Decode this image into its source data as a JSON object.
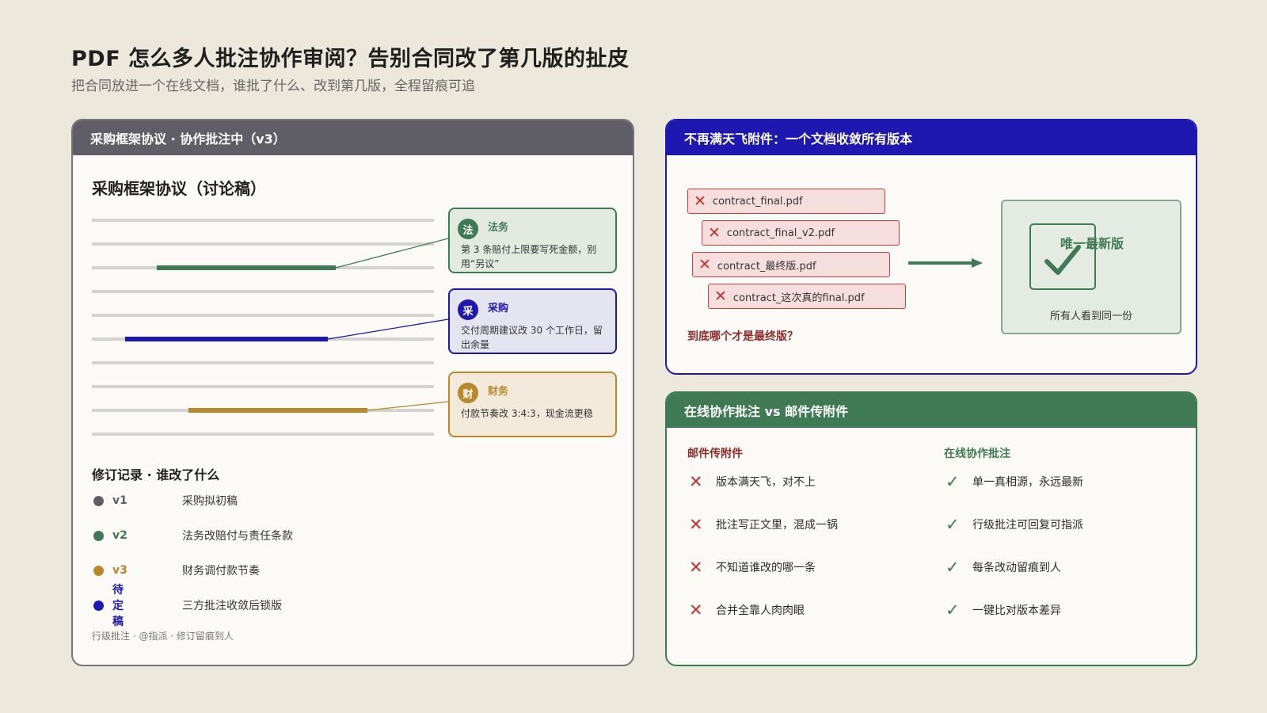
{
  "page": {
    "title": "PDF 怎么多人批注协作审阅？告别合同改了第几版的扯皮",
    "subtitle": "把合同放进一个在线文档，谁批了什么、改到第几版，全程留痕可追"
  },
  "doc_card": {
    "header": "采购框架协议 · 协作批注中（v3）",
    "doc_title": "采购框架协议（讨论稿）",
    "notes": [
      {
        "avatar": "法",
        "who": "法务",
        "text": "第 3 条赔付上限要写死金额，别用“另议”",
        "color": "#3f7a55"
      },
      {
        "avatar": "采",
        "who": "采购",
        "text": "交付周期建议改 30 个工作日，留出余量",
        "color": "#1e18b0"
      },
      {
        "avatar": "财",
        "who": "财务",
        "text": "付款节奏改 3:4:3，现金流更稳",
        "color": "#b8882c"
      }
    ],
    "revisions_title": "修订记录 · 谁改了什么",
    "revisions": [
      {
        "version": "v1",
        "desc": "采购拟初稿",
        "color": "#5f5e66"
      },
      {
        "version": "v2",
        "desc": "法务改赔付与责任条款",
        "color": "#3f7a55"
      },
      {
        "version": "v3",
        "desc": "财务调付款节奏",
        "color": "#b8882c"
      },
      {
        "version": "待定稿",
        "desc": "三方批注收敛后锁版",
        "color": "#1e18b0"
      }
    ],
    "footer": "行级批注 · @指派 · 修订留痕到人"
  },
  "versions_card": {
    "header": "不再满天飞附件：一个文档收敛所有版本",
    "files": [
      "contract_final.pdf",
      "contract_final_v2.pdf",
      "contract_最终版.pdf",
      "contract_这次真的final.pdf"
    ],
    "question": "到底哪个才是最终版？",
    "final_label": "唯一最新版",
    "final_sub": "所有人看到同一份"
  },
  "compare_card": {
    "header": "在线协作批注 vs 邮件传附件",
    "left_title": "邮件传附件",
    "right_title": "在线协作批注",
    "left_items": [
      "版本满天飞，对不上",
      "批注写正文里，混成一锅",
      "不知道谁改的哪一条",
      "合并全靠人肉肉眼"
    ],
    "right_items": [
      "单一真相源，永远最新",
      "行级批注可回复可指派",
      "每条改动留痕到人",
      "一键比对版本差异"
    ]
  },
  "colors": {
    "legal": "#3f7a55",
    "procurement": "#1e18b0",
    "finance": "#b8882c",
    "neutral": "#5f5e66",
    "error": "#c9302c"
  },
  "icons": {
    "bad": "x-icon",
    "good": "check-icon",
    "arrow": "arrow-right-icon"
  }
}
